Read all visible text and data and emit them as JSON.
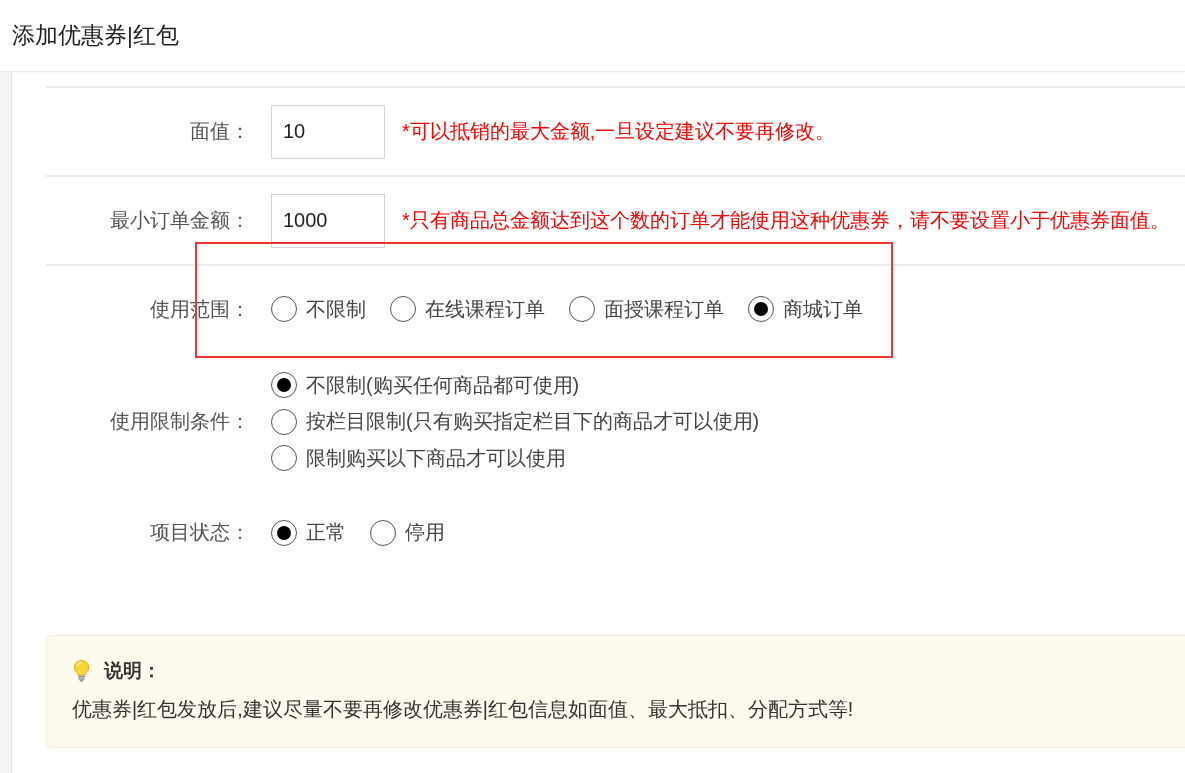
{
  "page": {
    "title": "添加优惠券|红包"
  },
  "form": {
    "rows": [
      {
        "kind": "input",
        "label": "面值：",
        "value": "10",
        "hint": "*可以抵销的最大金额,一旦设定建议不要再修改。",
        "highlighted": false
      },
      {
        "kind": "input",
        "label": "最小订单金额：",
        "value": "1000",
        "hint": "*只有商品总金额达到这个数的订单才能使用这种优惠券，请不要设置小于优惠券面值。",
        "highlighted": false
      },
      {
        "kind": "radio-inline",
        "label": "使用范围：",
        "highlighted": true,
        "options": [
          {
            "label": "不限制",
            "selected": false
          },
          {
            "label": "在线课程订单",
            "selected": false
          },
          {
            "label": "面授课程订单",
            "selected": false
          },
          {
            "label": "商城订单",
            "selected": true
          }
        ]
      },
      {
        "kind": "radio-stack",
        "label": "使用限制条件：",
        "highlighted": false,
        "options": [
          {
            "label": "不限制(购买任何商品都可使用)",
            "selected": true
          },
          {
            "label": "按栏目限制(只有购买指定栏目下的商品才可以使用)",
            "selected": false
          },
          {
            "label": "限制购买以下商品才可以使用",
            "selected": false
          }
        ]
      },
      {
        "kind": "radio-inline",
        "label": "项目状态：",
        "highlighted": false,
        "options": [
          {
            "label": "正常",
            "selected": true
          },
          {
            "label": "停用",
            "selected": false
          }
        ]
      }
    ]
  },
  "note": {
    "title": "说明：",
    "text": "优惠券|红包发放后,建议尽量不要再修改优惠券|红包信息如面值、最大抵扣、分配方式等!"
  }
}
